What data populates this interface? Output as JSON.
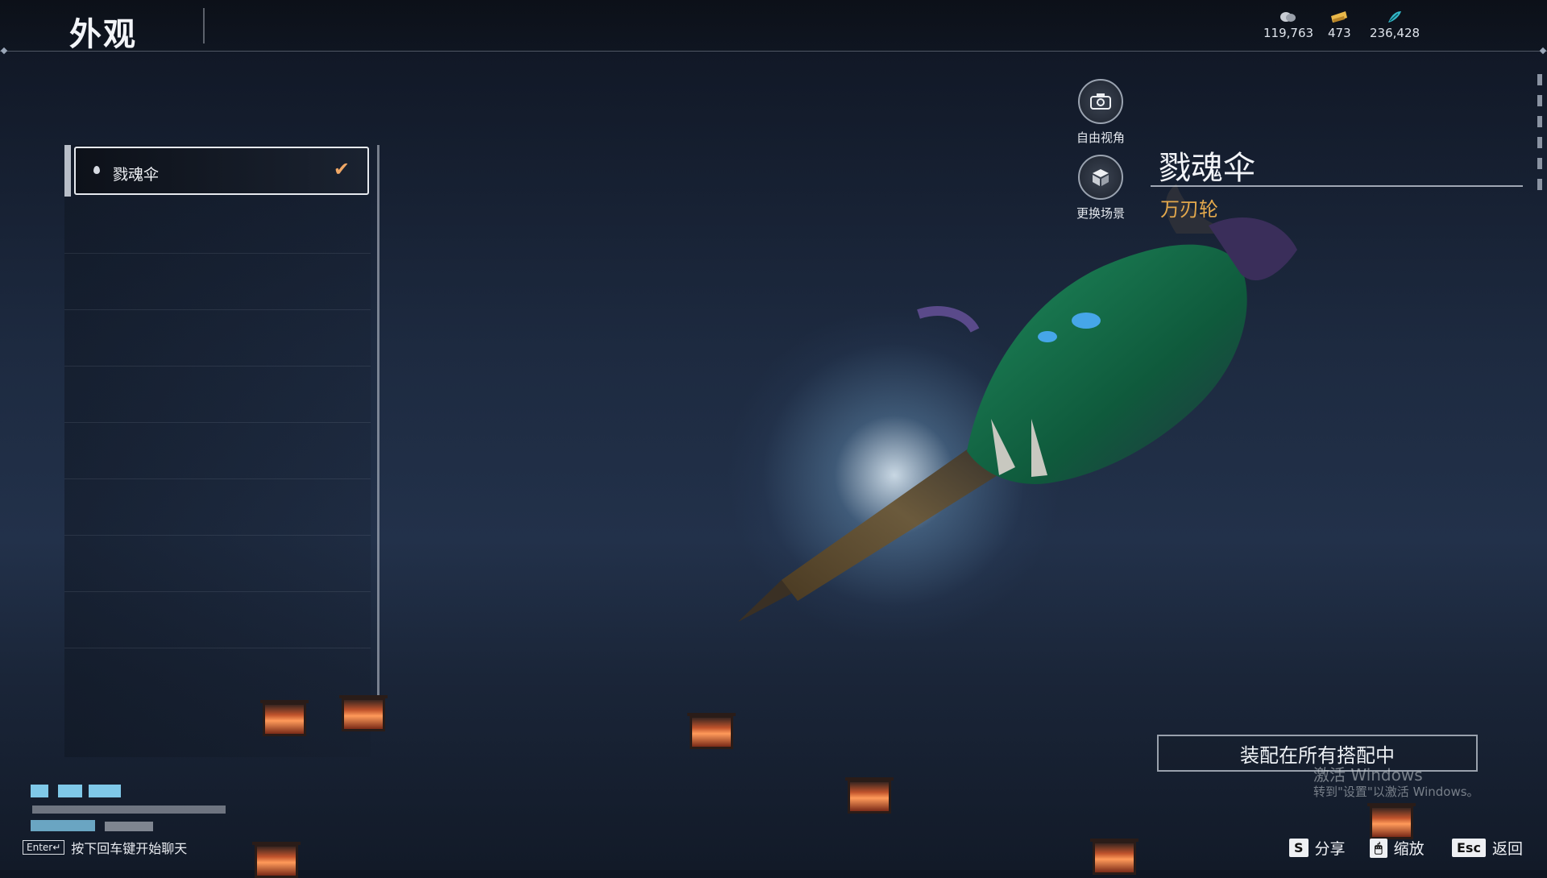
{
  "header": {
    "title": "外观"
  },
  "currencies": [
    {
      "icon": "coin-stack-icon",
      "value": "119,763",
      "color": "#c9cdd4"
    },
    {
      "icon": "gold-ticket-icon",
      "value": "473",
      "color": "#e9b84a"
    },
    {
      "icon": "jade-feather-icon",
      "value": "236,428",
      "color": "#34b8c8"
    }
  ],
  "list": {
    "items": [
      {
        "name": "戮魂伞",
        "selected": true
      }
    ]
  },
  "side_buttons": [
    {
      "icon": "camera-icon",
      "label": "自由视角"
    },
    {
      "icon": "scene-cube-icon",
      "label": "更换场景"
    }
  ],
  "weapon": {
    "name": "戮魂伞",
    "type": "万刃轮"
  },
  "equip_button": {
    "label": "装配在所有搭配中"
  },
  "watermark": {
    "line1": "激活 Windows",
    "line2": "转到\"设置\"以激活 Windows。"
  },
  "chat_hint": {
    "key": "Enter↵",
    "text": "按下回车键开始聊天"
  },
  "footer_hints": [
    {
      "key": "S",
      "label": "分享"
    },
    {
      "key": "🖱",
      "label": "缩放"
    },
    {
      "key": "Esc",
      "label": "返回"
    }
  ]
}
